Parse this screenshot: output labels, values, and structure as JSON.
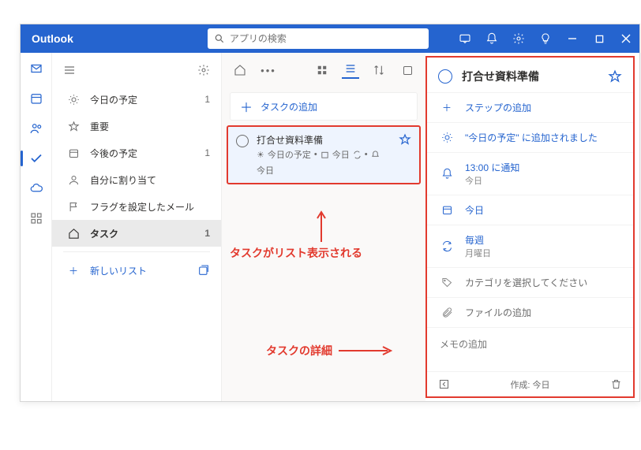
{
  "titlebar": {
    "app_name": "Outlook",
    "search_placeholder": "アプリの検索"
  },
  "nav": {
    "items": [
      {
        "icon": "sun",
        "label": "今日の予定",
        "count": "1"
      },
      {
        "icon": "star",
        "label": "重要",
        "count": ""
      },
      {
        "icon": "calendar",
        "label": "今後の予定",
        "count": "1"
      },
      {
        "icon": "user",
        "label": "自分に割り当て",
        "count": ""
      },
      {
        "icon": "flag",
        "label": "フラグを設定したメール",
        "count": ""
      },
      {
        "icon": "home",
        "label": "タスク",
        "count": "1"
      }
    ],
    "new_list": "新しいリスト"
  },
  "add_task_label": "タスクの追加",
  "task": {
    "title": "打合せ資料準備",
    "meta_today": "今日の予定",
    "meta_date": "今日",
    "meta_bell": "今日"
  },
  "annotations": {
    "list_note": "タスクがリスト表示される",
    "detail_note": "タスクの詳細"
  },
  "detail": {
    "title": "打合せ資料準備",
    "add_step": "ステップの追加",
    "added_to_today": "\"今日の予定\" に追加されました",
    "remind_time": "13:00 に通知",
    "remind_sub": "今日",
    "due": "今日",
    "repeat": "毎週",
    "repeat_sub": "月曜日",
    "category": "カテゴリを選択してください",
    "file": "ファイルの追加",
    "note_placeholder": "メモの追加",
    "created": "作成: 今日"
  }
}
